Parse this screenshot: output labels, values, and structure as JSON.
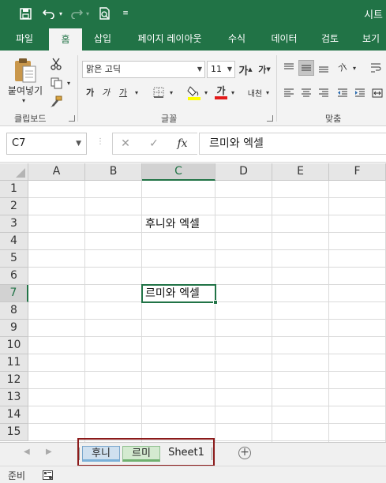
{
  "window": {
    "title": "시트"
  },
  "ribbon_tabs": [
    "파일",
    "홈",
    "삽입",
    "페이지 레이아웃",
    "수식",
    "데이터",
    "검토",
    "보기"
  ],
  "active_tab": "홈",
  "clipboard": {
    "paste_label": "붙여넣기",
    "group_label": "클립보드"
  },
  "font": {
    "name": "맑은 고딕",
    "size": "11",
    "grow_label": "가",
    "shrink_label": "가",
    "bold": "가",
    "italic": "가",
    "underline": "가",
    "color_label": "가",
    "phonetic_label": "내천",
    "group_label": "글꼴"
  },
  "alignment": {
    "orient_label": "가",
    "group_label": "맞춤"
  },
  "formula_bar": {
    "name_box": "C7",
    "value": "르미와 엑셀"
  },
  "grid": {
    "columns": [
      "A",
      "B",
      "C",
      "D",
      "E",
      "F"
    ],
    "rows": [
      "1",
      "2",
      "3",
      "4",
      "5",
      "6",
      "7",
      "8",
      "9",
      "10",
      "11",
      "12",
      "13",
      "14",
      "15"
    ],
    "selected_column": "C",
    "selected_row": "7",
    "cells": {
      "C3": "후니와 엑셀",
      "C7": "르미와 엑셀"
    }
  },
  "sheets": [
    "후니",
    "르미",
    "Sheet1"
  ],
  "status": {
    "text": "준비"
  },
  "colors": {
    "brand": "#217346",
    "highlight_box": "#8b1a1a",
    "font_color": "#e31b1b",
    "fill_color": "#ffff00"
  }
}
